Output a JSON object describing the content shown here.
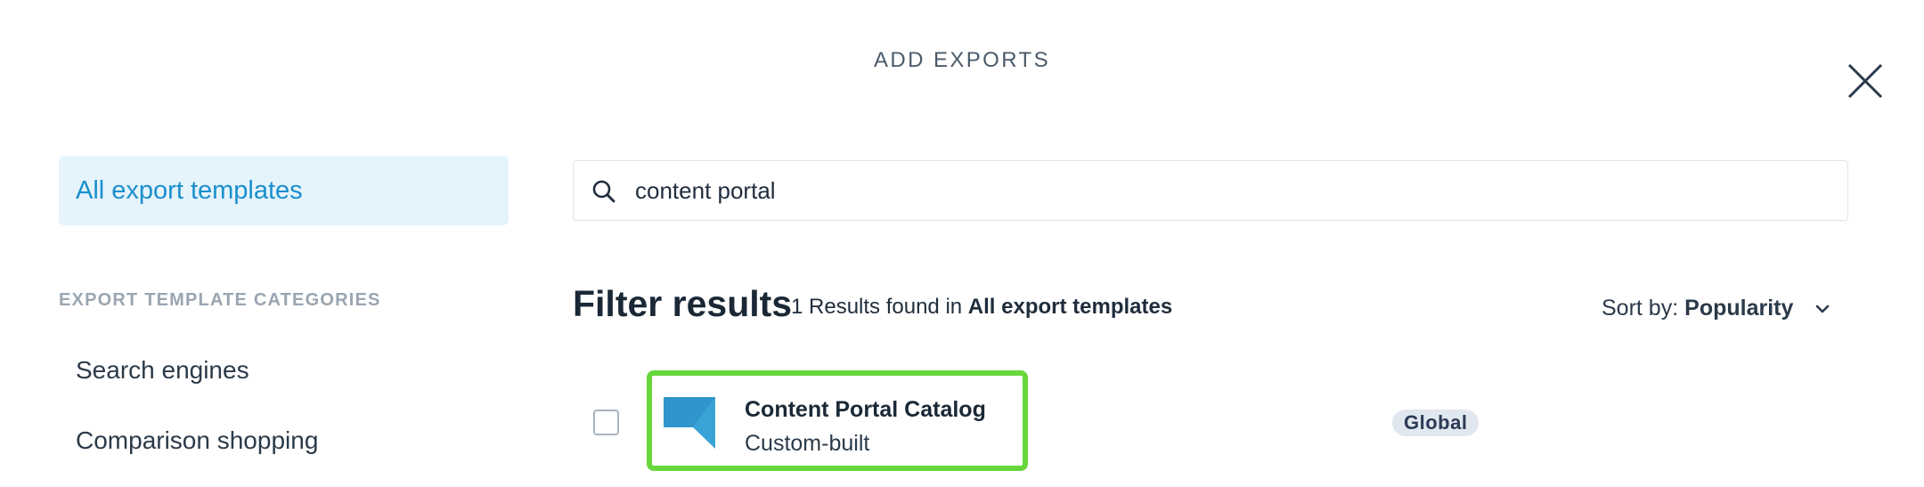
{
  "modal": {
    "title": "ADD EXPORTS"
  },
  "sidebar": {
    "active_item": "All export templates",
    "categories_heading": "EXPORT TEMPLATE CATEGORIES",
    "categories": [
      "Search engines",
      "Comparison shopping"
    ]
  },
  "search": {
    "value": "content portal",
    "icon": "search-icon"
  },
  "results": {
    "heading": "Filter results",
    "count_text": "1 Results found in",
    "scope": "All export templates",
    "sort_label": "Sort by:",
    "sort_value": "Popularity"
  },
  "items": [
    {
      "title": "Content Portal Catalog",
      "subtitle": "Custom-built",
      "badge": "Global",
      "selected": false
    }
  ],
  "colors": {
    "accent": "#1a8fce",
    "active_bg": "#e5f3fb",
    "highlight": "#67d73c",
    "logo": "#3aa3d6"
  }
}
